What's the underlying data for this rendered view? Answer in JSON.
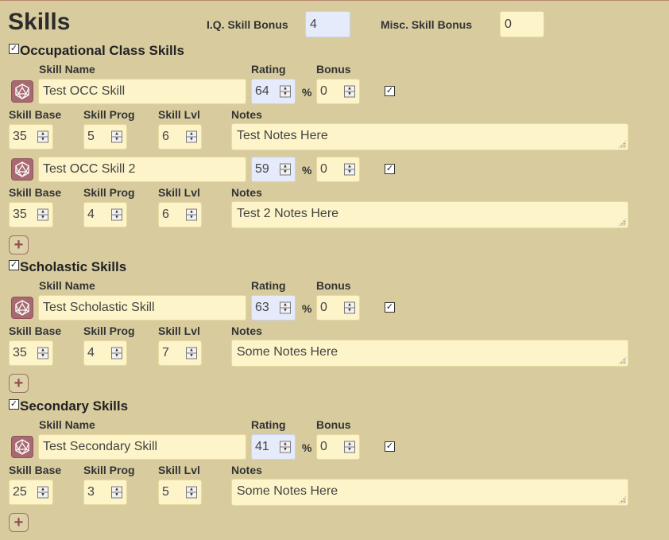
{
  "page": {
    "title": "Skills"
  },
  "header": {
    "iq_label": "I.Q. Skill Bonus",
    "iq_value": "4",
    "misc_label": "Misc. Skill Bonus",
    "misc_value": "0"
  },
  "labels": {
    "skill_name": "Skill Name",
    "rating": "Rating",
    "bonus": "Bonus",
    "skill_base": "Skill Base",
    "skill_prog": "Skill Prog",
    "skill_lvl": "Skill Lvl",
    "notes": "Notes",
    "percent": "%",
    "add": "+"
  },
  "colors": {
    "background": "#d8cc9f",
    "field": "#fdf4c9",
    "rating_field": "#e6ebfb",
    "dice": "#a86a70"
  },
  "sections": [
    {
      "title": "Occupational Class Skills",
      "checked": true,
      "skills": [
        {
          "name": "Test OCC Skill",
          "rating": "64",
          "bonus": "0",
          "checked": true,
          "base": "35",
          "prog": "5",
          "lvl": "6",
          "notes": "Test Notes Here"
        },
        {
          "name": "Test OCC Skill 2",
          "rating": "59",
          "bonus": "0",
          "checked": true,
          "base": "35",
          "prog": "4",
          "lvl": "6",
          "notes": "Test 2 Notes Here"
        }
      ]
    },
    {
      "title": "Scholastic Skills",
      "checked": true,
      "skills": [
        {
          "name": "Test Scholastic Skill",
          "rating": "63",
          "bonus": "0",
          "checked": true,
          "base": "35",
          "prog": "4",
          "lvl": "7",
          "notes": "Some Notes Here"
        }
      ]
    },
    {
      "title": "Secondary Skills",
      "checked": true,
      "skills": [
        {
          "name": "Test Secondary Skill",
          "rating": "41",
          "bonus": "0",
          "checked": true,
          "base": "25",
          "prog": "3",
          "lvl": "5",
          "notes": "Some Notes Here"
        }
      ]
    }
  ]
}
